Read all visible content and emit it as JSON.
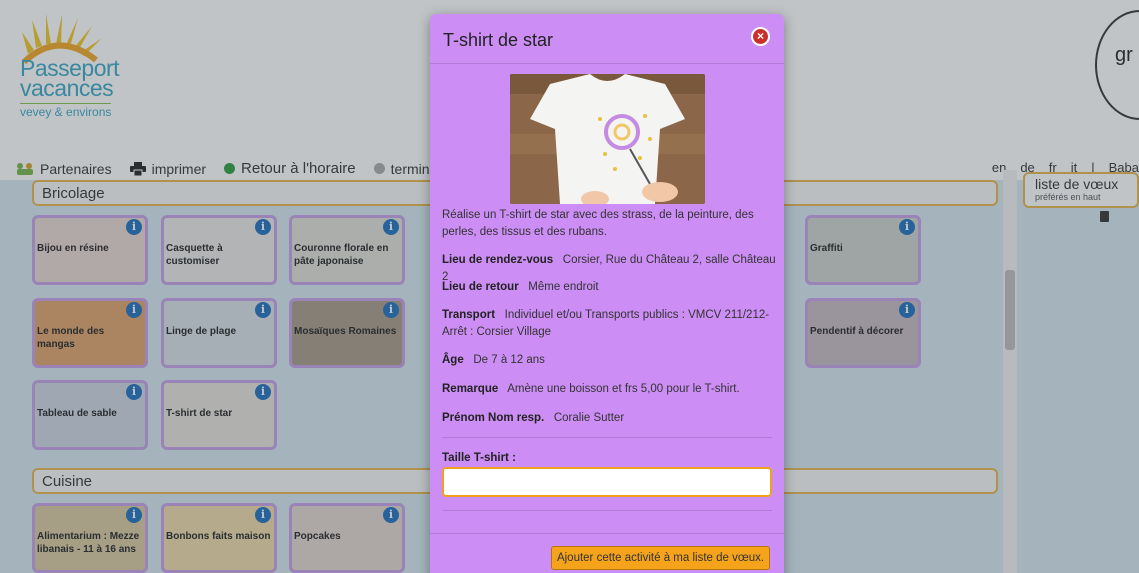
{
  "logo": {
    "title": "Passeport vacances",
    "subtitle": "vevey & environs"
  },
  "nav": {
    "partners": "Partenaires",
    "print": "imprimer",
    "back": "Retour à l'horaire",
    "finish": "terminer"
  },
  "langs": [
    "en",
    "de",
    "fr",
    "it",
    "|",
    "Baba"
  ],
  "right_logo_text": "gr",
  "sections": {
    "bricolage": "Bricolage",
    "cuisine": "Cuisine"
  },
  "tiles": {
    "bijou": "Bijou en résine",
    "casquette": "Casquette à customiser",
    "couronne": "Couronne florale en pâte japonaise",
    "graffiti": "Graffiti",
    "mangas": "Le monde des mangas",
    "linge": "Linge de plage",
    "mosaiques": "Mosaïques Romaines",
    "pendentif": "Pendentif à décorer",
    "tableau": "Tableau de sable",
    "tshirt": "T-shirt de star",
    "alimentarium": "Alimentarium : Mezze libanais - 11 à 16 ans",
    "bonbons": "Bonbons faits maison",
    "popcakes": "Popcakes"
  },
  "wishlist": {
    "title": "liste de vœux",
    "subtitle": "préférés en haut"
  },
  "modal": {
    "title": "T-shirt de star",
    "description": "Réalise un T-shirt de star avec des strass, de la peinture, des perles, des tissus et des rubans.",
    "rdv_label": "Lieu de rendez-vous",
    "rdv_value": "Corsier, Rue du Château 2, salle Château 2",
    "retour_label": "Lieu de retour",
    "retour_value": "Même endroit",
    "transport_label": "Transport",
    "transport_value": "Individuel et/ou Transports publics : VMCV 211/212- Arrêt : Corsier Village",
    "age_label": "Âge",
    "age_value": "De 7 à 12 ans",
    "remarque_label": "Remarque",
    "remarque_value": "Amène une boisson et frs 5,00 pour le T-shirt.",
    "resp_label": "Prénom Nom resp.",
    "resp_value": "Coralie Sutter",
    "field_label": "Taille T-shirt :",
    "field_value": "",
    "add_button": "Ajouter cette activité à ma liste de vœux."
  },
  "colors": {
    "modal_bg": "#cc8ef5",
    "button": "#f5a31a",
    "field_border": "#f0a020",
    "section_border": "#e8b64a",
    "tile_border": "#c8a0e8",
    "info_icon": "#1e6fbf",
    "close_icon": "#c9302c"
  },
  "icons": {
    "close": "close-icon",
    "info": "info-icon",
    "partners": "handshake-icon",
    "print": "printer-icon",
    "trash": "trash-icon"
  }
}
